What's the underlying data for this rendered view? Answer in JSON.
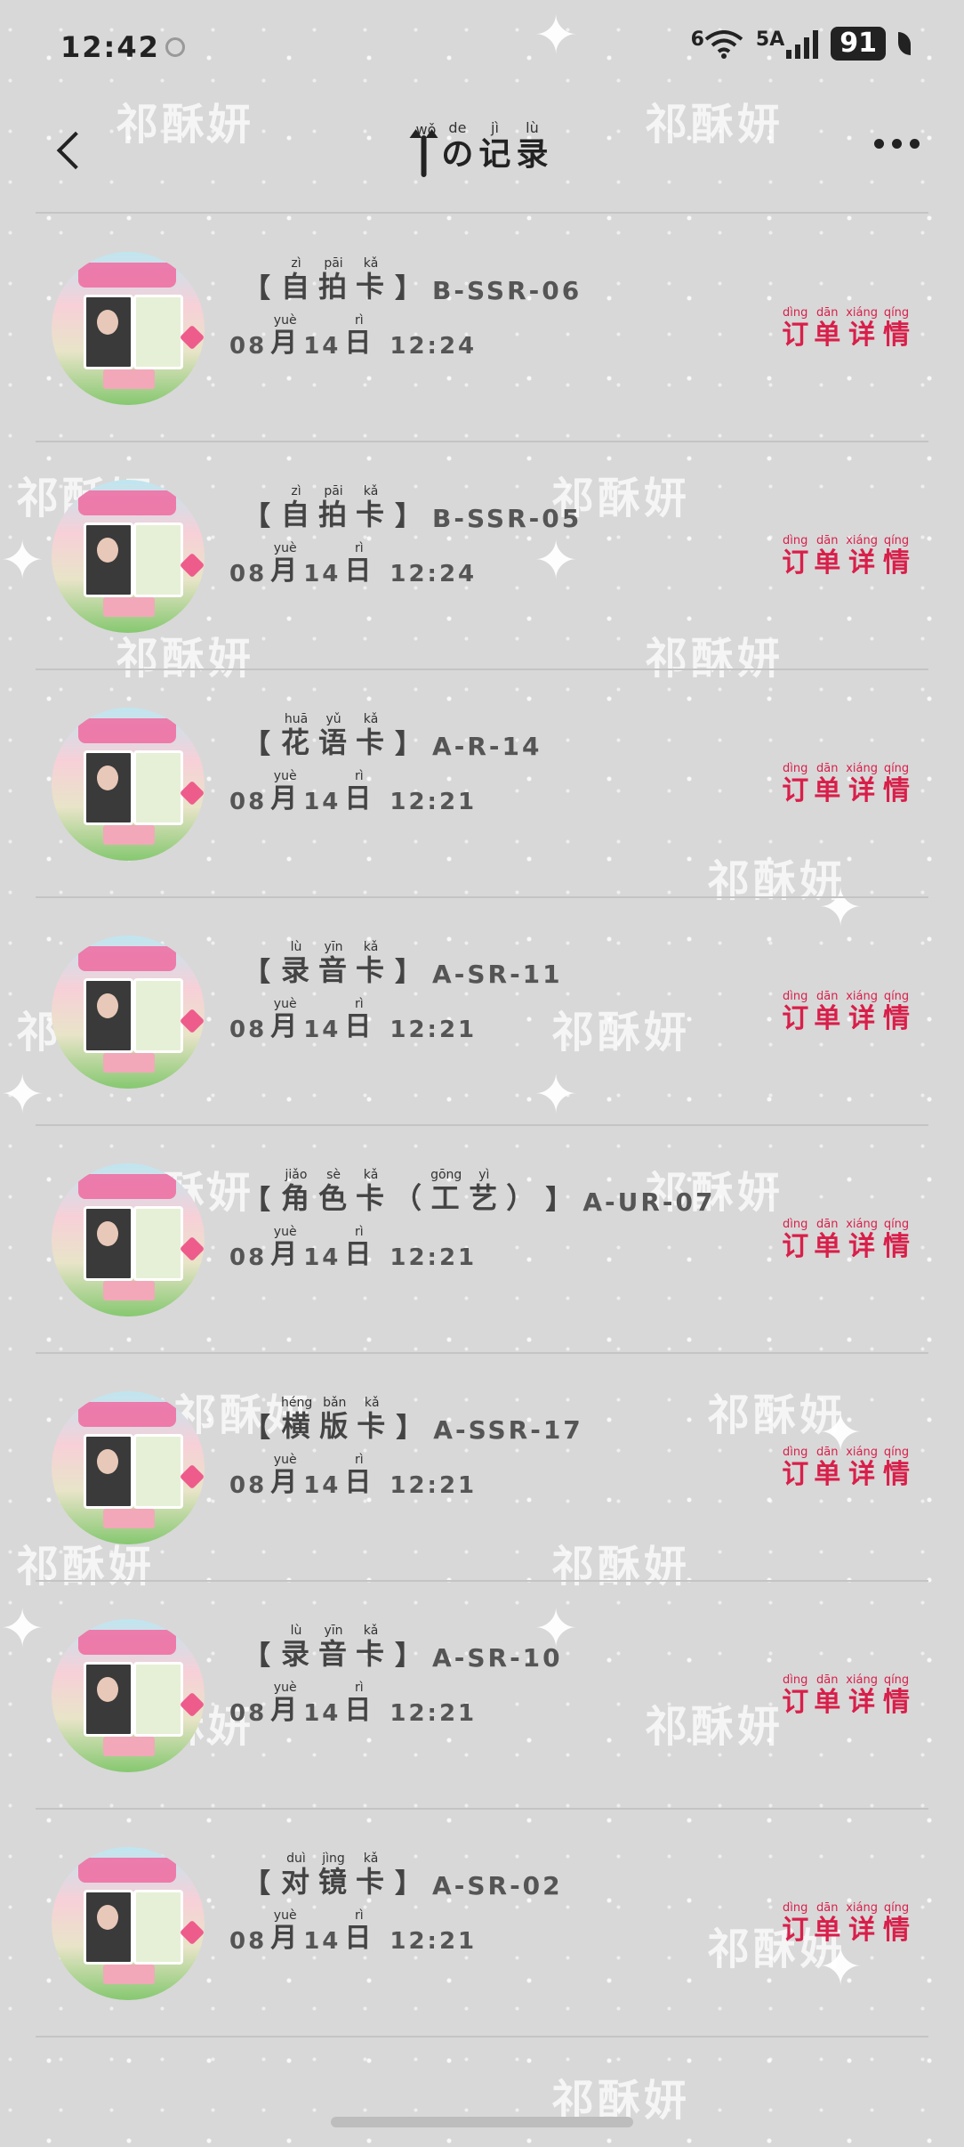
{
  "status_bar": {
    "time": "12:42",
    "wifi_label": "6",
    "cell_label": "5A",
    "battery": "91",
    "icons": [
      "circle-dot-icon",
      "wifi-icon",
      "signal-icon",
      "battery-icon",
      "leaf-icon"
    ]
  },
  "header": {
    "title_parts": [
      {
        "char": "の",
        "pinyin": "de"
      },
      {
        "char": "记",
        "pinyin": "jì"
      },
      {
        "char": "录",
        "pinyin": "lù"
      }
    ],
    "title_prefix_pinyin": "wǒ",
    "back_icon": "chevron-left-icon",
    "more_icon": "more-dots-icon"
  },
  "watermark_text": "祁酥妍",
  "detail_label": [
    {
      "char": "订",
      "pinyin": "dìng"
    },
    {
      "char": "单",
      "pinyin": "dān"
    },
    {
      "char": "详",
      "pinyin": "xiáng"
    },
    {
      "char": "情",
      "pinyin": "qíng"
    }
  ],
  "date_parts": {
    "month": "08",
    "month_char": "月",
    "month_pinyin": "yuè",
    "day": "14",
    "day_char": "日",
    "day_pinyin": "rì"
  },
  "records": [
    {
      "name": [
        {
          "char": "自",
          "pinyin": "zì"
        },
        {
          "char": "拍",
          "pinyin": "pāi"
        },
        {
          "char": "卡",
          "pinyin": "kǎ"
        }
      ],
      "code": "B-SSR-06",
      "time": "12:24"
    },
    {
      "name": [
        {
          "char": "自",
          "pinyin": "zì"
        },
        {
          "char": "拍",
          "pinyin": "pāi"
        },
        {
          "char": "卡",
          "pinyin": "kǎ"
        }
      ],
      "code": "B-SSR-05",
      "time": "12:24"
    },
    {
      "name": [
        {
          "char": "花",
          "pinyin": "huā"
        },
        {
          "char": "语",
          "pinyin": "yǔ"
        },
        {
          "char": "卡",
          "pinyin": "kǎ"
        }
      ],
      "code": "A-R-14",
      "time": "12:21"
    },
    {
      "name": [
        {
          "char": "录",
          "pinyin": "lù"
        },
        {
          "char": "音",
          "pinyin": "yīn"
        },
        {
          "char": "卡",
          "pinyin": "kǎ"
        }
      ],
      "code": "A-SR-11",
      "time": "12:21"
    },
    {
      "name": [
        {
          "char": "角",
          "pinyin": "jiǎo"
        },
        {
          "char": "色",
          "pinyin": "sè"
        },
        {
          "char": "卡",
          "pinyin": "kǎ"
        },
        {
          "char": "（",
          "pinyin": ""
        },
        {
          "char": "工",
          "pinyin": "gōng"
        },
        {
          "char": "艺",
          "pinyin": "yì"
        },
        {
          "char": "）",
          "pinyin": ""
        }
      ],
      "code": "A-UR-07",
      "time": "12:21"
    },
    {
      "name": [
        {
          "char": "横",
          "pinyin": "héng"
        },
        {
          "char": "版",
          "pinyin": "bǎn"
        },
        {
          "char": "卡",
          "pinyin": "kǎ"
        }
      ],
      "code": "A-SSR-17",
      "time": "12:21"
    },
    {
      "name": [
        {
          "char": "录",
          "pinyin": "lù"
        },
        {
          "char": "音",
          "pinyin": "yīn"
        },
        {
          "char": "卡",
          "pinyin": "kǎ"
        }
      ],
      "code": "A-SR-10",
      "time": "12:21"
    },
    {
      "name": [
        {
          "char": "对",
          "pinyin": "duì"
        },
        {
          "char": "镜",
          "pinyin": "jìng"
        },
        {
          "char": "卡",
          "pinyin": "kǎ"
        }
      ],
      "code": "A-SR-02",
      "time": "12:21"
    }
  ]
}
